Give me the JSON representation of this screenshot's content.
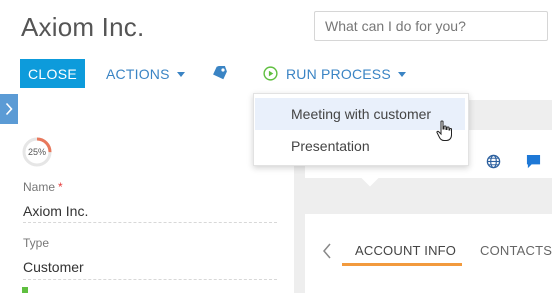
{
  "header": {
    "title": "Axiom Inc.",
    "search_placeholder": "What can I do for you?"
  },
  "toolbar": {
    "close_label": "CLOSE",
    "actions_label": "ACTIONS",
    "run_process_label": "RUN PROCESS"
  },
  "run_process_menu": {
    "items": [
      {
        "label": "Meeting with customer"
      },
      {
        "label": "Presentation"
      }
    ]
  },
  "profile": {
    "completeness_text": "25%",
    "completeness": 0.25,
    "name_label": "Name",
    "required_mark": "*",
    "name_value": "Axiom Inc.",
    "type_label": "Type",
    "type_value": "Customer"
  },
  "tabs": {
    "items": [
      {
        "label": "ACCOUNT INFO"
      },
      {
        "label": "CONTACTS"
      }
    ],
    "active": 0
  },
  "icons": {
    "sidebar_toggle": "chevron-right-icon",
    "tag": "tag-icon",
    "run_process": "play-circle-icon",
    "globe": "globe-icon",
    "chat": "chat-bubble-icon",
    "tab_back": "chevron-left-icon"
  },
  "colors": {
    "primary": "#0d9bdb",
    "link": "#3a84c4",
    "run_process": "#5fbf3f",
    "tab_active": "#f29a3d",
    "progress": "#e8785c",
    "required": "#e63c3c",
    "sidebar_toggle": "#5b9bd5"
  }
}
